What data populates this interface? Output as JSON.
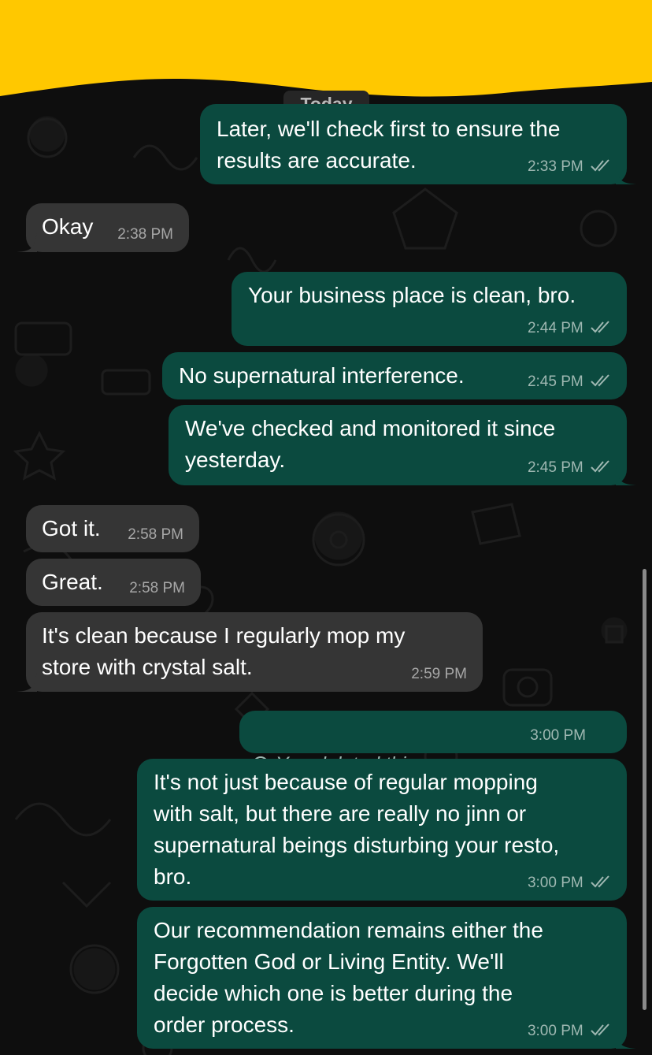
{
  "chat": {
    "date_label": "Today",
    "messages": [
      {
        "direction": "out",
        "text": "Later, we'll check first to ensure the\nresults are accurate.",
        "time": "2:33 PM",
        "read": true
      },
      {
        "direction": "in",
        "text": "Okay",
        "time": "2:38 PM"
      },
      {
        "direction": "out",
        "text": "Your business place is clean, bro.",
        "time": "2:44 PM",
        "read": true
      },
      {
        "direction": "out",
        "text": "No supernatural interference.",
        "time": "2:45 PM",
        "read": true
      },
      {
        "direction": "out",
        "text": "We've checked and monitored it since\nyesterday.",
        "time": "2:45 PM",
        "read": true
      },
      {
        "direction": "in",
        "text": "Got it.",
        "time": "2:58 PM"
      },
      {
        "direction": "in",
        "text": "Great.",
        "time": "2:58 PM"
      },
      {
        "direction": "in",
        "text": "It's clean because I regularly mop my\nstore with crystal salt.",
        "time": "2:59 PM"
      },
      {
        "direction": "out",
        "text": "You deleted this message.",
        "time": "3:00 PM",
        "deleted": true
      },
      {
        "direction": "out",
        "text": "It's not just because of regular mopping\nwith salt, but there are really no jinn or\nsupernatural beings disturbing your resto,\nbro.",
        "time": "3:00 PM",
        "read": true
      },
      {
        "direction": "out",
        "text": "Our recommendation remains either the\nForgotten God or Living Entity. We'll\ndecide which one is better during the\norder process.",
        "time": "3:00 PM",
        "read": true
      }
    ]
  },
  "icons": {
    "read_receipt": "double-check-icon",
    "deleted": "prohibited-icon"
  },
  "colors": {
    "banner": "#ffc800",
    "outgoing_bubble": "#0b4a3f",
    "incoming_bubble": "#353535",
    "background": "#0e0e0e"
  }
}
